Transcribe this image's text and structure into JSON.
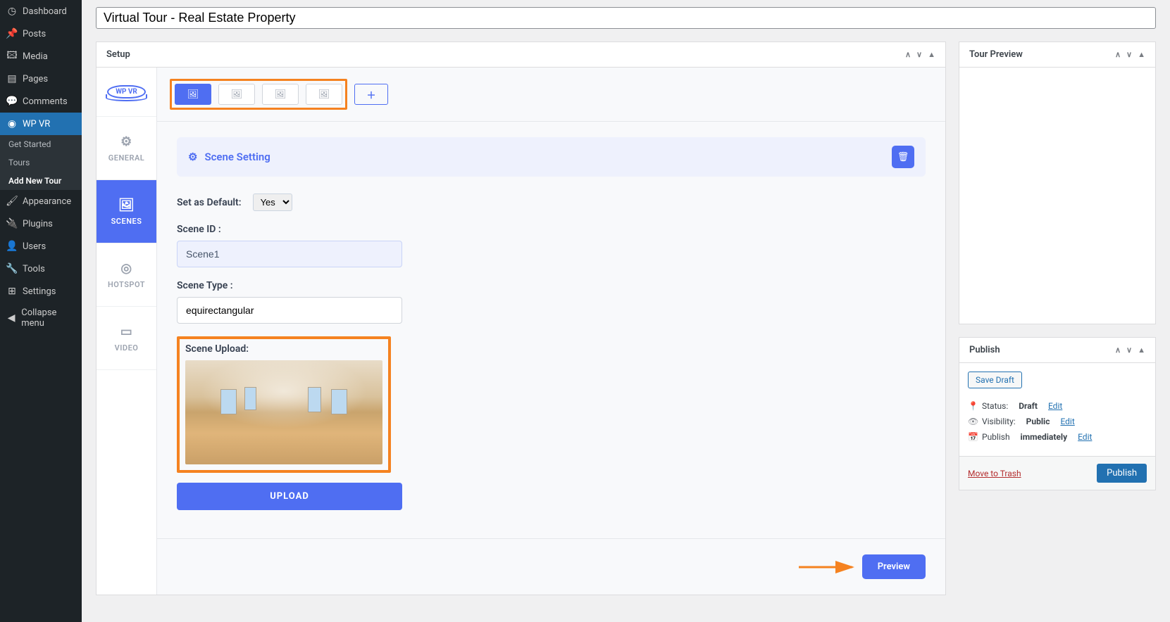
{
  "title_input": "Virtual Tour - Real Estate Property",
  "sidebar": {
    "items": [
      {
        "label": "Dashboard"
      },
      {
        "label": "Posts"
      },
      {
        "label": "Media"
      },
      {
        "label": "Pages"
      },
      {
        "label": "Comments"
      },
      {
        "label": "WP VR"
      },
      {
        "label": "Appearance"
      },
      {
        "label": "Plugins"
      },
      {
        "label": "Users"
      },
      {
        "label": "Tools"
      },
      {
        "label": "Settings"
      },
      {
        "label": "Collapse menu"
      }
    ],
    "submenu": [
      {
        "label": "Get Started"
      },
      {
        "label": "Tours"
      },
      {
        "label": "Add New Tour"
      }
    ]
  },
  "setup": {
    "title": "Setup",
    "logo": "WP VR",
    "vtabs": {
      "general": "GENERAL",
      "scenes": "SCENES",
      "hotspot": "HOTSPOT",
      "video": "VIDEO"
    },
    "scene_heading": "Scene Setting",
    "set_default_label": "Set as Default:",
    "set_default_value": "Yes",
    "scene_id_label": "Scene ID :",
    "scene_id_value": "Scene1",
    "scene_type_label": "Scene Type :",
    "scene_type_value": "equirectangular",
    "scene_upload_label": "Scene Upload:",
    "upload_btn": "UPLOAD",
    "preview_btn": "Preview"
  },
  "tour_preview": {
    "title": "Tour Preview"
  },
  "publish": {
    "title": "Publish",
    "save_draft": "Save Draft",
    "status_label": "Status:",
    "status_value": "Draft",
    "visibility_label": "Visibility:",
    "visibility_value": "Public",
    "publish_label": "Publish",
    "publish_value": "immediately",
    "edit": "Edit",
    "trash": "Move to Trash",
    "publish_btn": "Publish"
  }
}
